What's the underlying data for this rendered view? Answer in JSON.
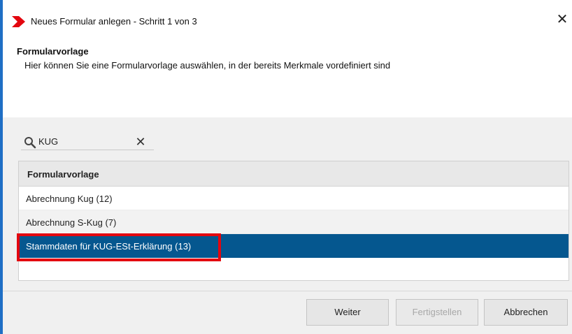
{
  "window": {
    "title": "Neues Formular anlegen - Schritt 1 von 3",
    "close_glyph": "✕",
    "logo_icon": "red-chevron-logo",
    "accent_color": "#1f6fc5"
  },
  "header": {
    "title": "Formularvorlage",
    "description": "Hier können Sie eine Formularvorlage auswählen, in der bereits Merkmale vordefiniert sind"
  },
  "search": {
    "value": "KUG",
    "icon": "search-icon",
    "clear_glyph": "✕"
  },
  "table": {
    "header": "Formularvorlage",
    "rows": [
      {
        "label": "Abrechnung Kug (12)",
        "selected": false
      },
      {
        "label": "Abrechnung S-Kug (7)",
        "selected": false
      },
      {
        "label": "Stammdaten für KUG-ESt-Erklärung (13)",
        "selected": true
      }
    ],
    "selected_color": "#05578f",
    "highlight_color": "#e3060f"
  },
  "buttons": {
    "next": "Weiter",
    "finish": "Fertigstellen",
    "cancel": "Abbrechen"
  }
}
